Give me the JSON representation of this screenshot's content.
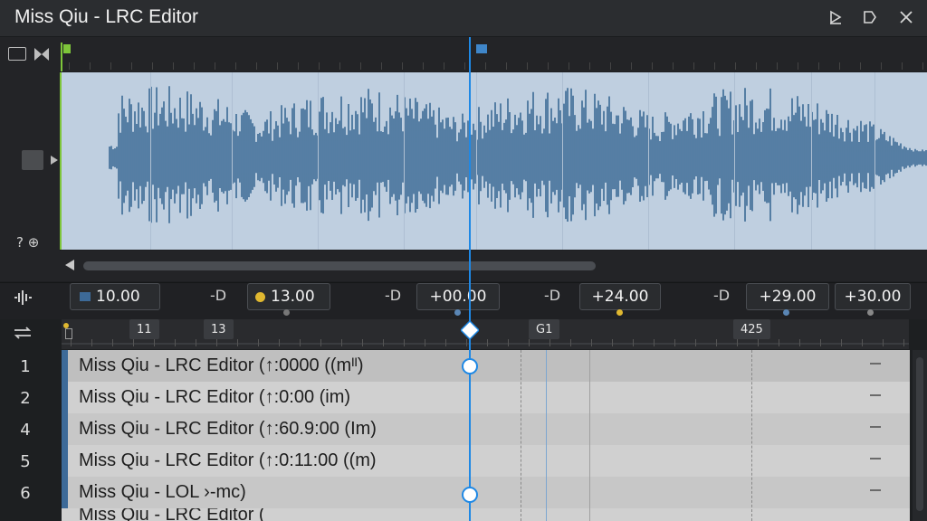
{
  "app": {
    "title": "Miss Qiu - LRC Editor"
  },
  "colors": {
    "accent": "#1e88e5",
    "waveform": "#3b6a94",
    "green": "#7ec63a",
    "yellow": "#e0b830"
  },
  "window_controls": [
    {
      "name": "play-icon"
    },
    {
      "name": "tag-icon"
    },
    {
      "name": "close-icon"
    }
  ],
  "markers": [
    {
      "value": "10.00",
      "dot": "square"
    },
    {
      "value": "13.00",
      "dot": "yellow"
    },
    {
      "value": "+00.00",
      "dot": "none"
    },
    {
      "value": "+24.00",
      "dot": "none"
    },
    {
      "value": "+29.00",
      "dot": "none"
    },
    {
      "value": "+30.00",
      "dot": "none"
    }
  ],
  "marker_separators": [
    "-D",
    "-D",
    "-D",
    "-D"
  ],
  "ruler_labels": [
    "11",
    "13",
    "G1",
    "425"
  ],
  "side_labels": {
    "help": "? ⊕"
  },
  "lines": [
    {
      "number": "1",
      "text": "Miss Qiu - LRC Editor (↑:0000 ((mᴵᴵ)"
    },
    {
      "number": "2",
      "text": "Miss Qiu - LRC Editor (↑:0:00 (im)"
    },
    {
      "number": "4",
      "text": "Miss Qiu - LRC Editor (↑:60.9:00 (Im)"
    },
    {
      "number": "5",
      "text": "Miss Qiu - LRC Editor (↑:0:11:00 ((m)"
    },
    {
      "number": "6",
      "text": "Miss Qiu - LOL ›-mc)"
    },
    {
      "number": "",
      "text": "Miss Qiu - LRC Editor ("
    }
  ]
}
